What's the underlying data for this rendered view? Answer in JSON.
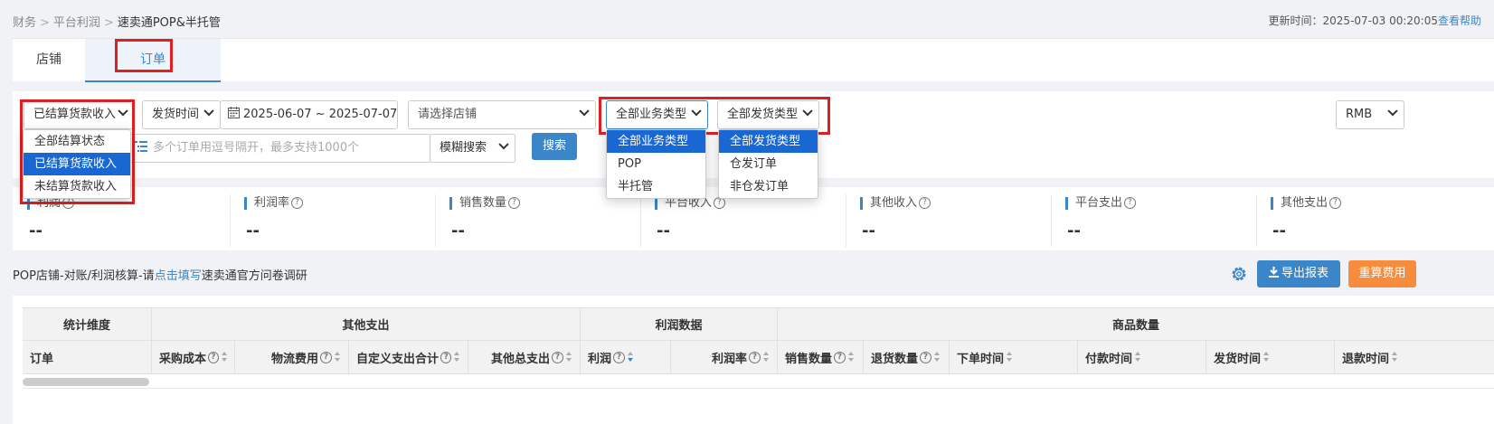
{
  "breadcrumb": {
    "items": [
      "财务",
      "平台利润"
    ],
    "current": "速卖通POP&半托管",
    "separator": ">"
  },
  "update": {
    "label": "更新时间：",
    "value": "2025-07-03 00:20:05",
    "help": "查看帮助"
  },
  "tabs": [
    {
      "label": "店铺"
    },
    {
      "label": "订单"
    }
  ],
  "filters": {
    "settlement": {
      "value": "已结算货款收入",
      "options": [
        "全部结算状态",
        "已结算货款收入",
        "未结算货款收入"
      ]
    },
    "time_type": {
      "value": "发货时间"
    },
    "date_range": {
      "value": "2025-06-07 ~ 2025-07-07"
    },
    "store": {
      "placeholder": "请选择店铺"
    },
    "business_type": {
      "value": "全部业务类型",
      "options": [
        "全部业务类型",
        "POP",
        "半托管"
      ]
    },
    "ship_type": {
      "value": "全部发货类型",
      "options": [
        "全部发货类型",
        "仓发订单",
        "非仓发订单"
      ]
    },
    "currency": {
      "value": "RMB"
    },
    "order_input": {
      "placeholder": "多个订单用逗号隔开，最多支持1000个"
    },
    "match_mode": {
      "value": "模糊搜索"
    },
    "search_label": "搜索"
  },
  "stats": [
    {
      "label": "利润",
      "value": "--"
    },
    {
      "label": "利润率",
      "value": "--"
    },
    {
      "label": "销售数量",
      "value": "--"
    },
    {
      "label": "平台收入",
      "value": "--"
    },
    {
      "label": "其他收入",
      "value": "--"
    },
    {
      "label": "平台支出",
      "value": "--"
    },
    {
      "label": "其他支出",
      "value": "--"
    }
  ],
  "survey": {
    "prefix": "POP店铺-对账/利润核算-请",
    "link": "点击填写",
    "suffix": "速卖通官方问卷调研"
  },
  "actions": {
    "export": "导出报表",
    "recalc": "重算费用"
  },
  "table": {
    "groups": [
      "统计维度",
      "其他支出",
      "利润数据",
      "商品数量"
    ],
    "columns": [
      "订单",
      "采购成本",
      "物流费用",
      "自定义支出合计",
      "其他总支出",
      "利润",
      "利润率",
      "销售数量",
      "退货数量",
      "下单时间",
      "付款时间",
      "发货时间",
      "退款时间"
    ]
  },
  "colors": {
    "accent": "#3a86c8",
    "highlight": "#e02020",
    "orange": "#f78d3c",
    "selected": "#1967d2"
  }
}
